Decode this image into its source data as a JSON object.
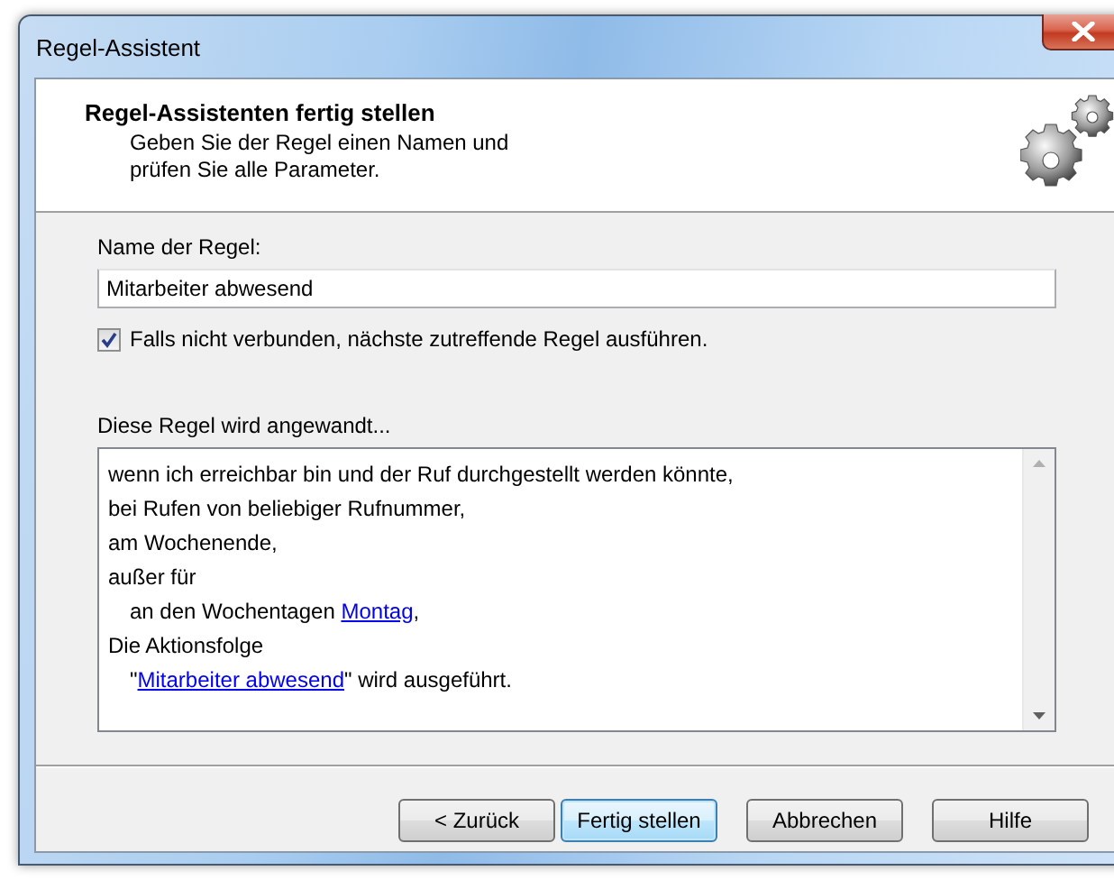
{
  "window": {
    "title": "Regel-Assistent"
  },
  "header": {
    "title": "Regel-Assistenten fertig stellen",
    "subtitle_lines": [
      "Geben Sie der Regel einen Namen und",
      "prüfen Sie alle Parameter."
    ]
  },
  "name_field": {
    "label": "Name der Regel:",
    "value": "Mitarbeiter abwesend"
  },
  "fallback_checkbox": {
    "label": "Falls nicht verbunden, nächste zutreffende Regel ausführen.",
    "checked": true
  },
  "summary": {
    "label": "Diese Regel wird angewandt...",
    "lines": [
      {
        "indented": false,
        "parts": [
          {
            "kind": "text",
            "text": "wenn ich erreichbar bin und der Ruf durchgestellt werden könnte,"
          }
        ]
      },
      {
        "indented": false,
        "parts": [
          {
            "kind": "text",
            "text": "bei Rufen von beliebiger Rufnummer,"
          }
        ]
      },
      {
        "indented": false,
        "parts": [
          {
            "kind": "text",
            "text": "am Wochenende,"
          }
        ]
      },
      {
        "indented": false,
        "parts": [
          {
            "kind": "text",
            "text": "außer für"
          }
        ]
      },
      {
        "indented": true,
        "parts": [
          {
            "kind": "text",
            "text": "an den Wochentagen "
          },
          {
            "kind": "link",
            "text": "Montag"
          },
          {
            "kind": "text",
            "text": ","
          }
        ]
      },
      {
        "indented": false,
        "parts": [
          {
            "kind": "text",
            "text": "Die Aktionsfolge"
          }
        ]
      },
      {
        "indented": true,
        "parts": [
          {
            "kind": "text",
            "text": "\""
          },
          {
            "kind": "link",
            "text": "Mitarbeiter abwesend"
          },
          {
            "kind": "text",
            "text": "\" wird ausgeführt."
          }
        ]
      }
    ]
  },
  "buttons": [
    {
      "label": "< Zurück",
      "default": false
    },
    {
      "label": "Fertig stellen",
      "default": true
    },
    {
      "label": "Abbrechen",
      "default": false
    },
    {
      "label": "Hilfe",
      "default": false
    }
  ]
}
